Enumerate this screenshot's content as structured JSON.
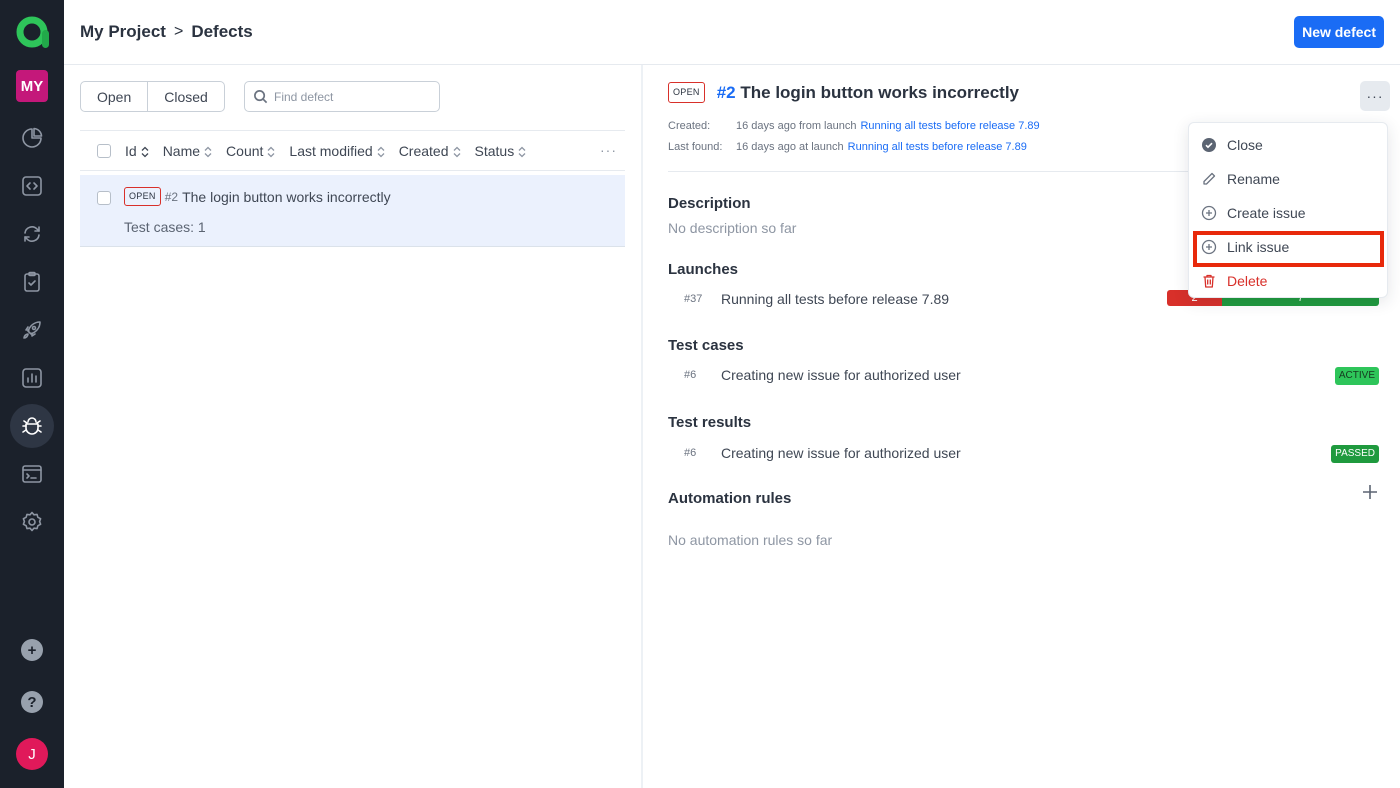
{
  "sidebar": {
    "project_badge": "MY",
    "nav": [
      {
        "name": "dashboards",
        "icon": "pie-chart-icon",
        "active": false
      },
      {
        "name": "code",
        "icon": "code-icon",
        "active": false
      },
      {
        "name": "jobs",
        "icon": "refresh-icon",
        "active": false
      },
      {
        "name": "test-cases",
        "icon": "clipboard-check-icon",
        "active": false
      },
      {
        "name": "launches",
        "icon": "rocket-icon",
        "active": false
      },
      {
        "name": "analytics",
        "icon": "bar-chart-icon",
        "active": false
      },
      {
        "name": "defects",
        "icon": "bug-icon",
        "active": true
      },
      {
        "name": "terminal",
        "icon": "terminal-icon",
        "active": false
      },
      {
        "name": "settings",
        "icon": "gear-icon",
        "active": false
      }
    ],
    "add_label": "+",
    "help_label": "?",
    "avatar_initial": "J"
  },
  "header": {
    "breadcrumb": [
      "My Project",
      "Defects"
    ],
    "breadcrumb_separator": ">",
    "new_defect_label": "New defect"
  },
  "list": {
    "filters": [
      "Open",
      "Closed"
    ],
    "search_placeholder": "Find defect",
    "columns": [
      "Id",
      "Name",
      "Count",
      "Last modified",
      "Created",
      "Status"
    ],
    "more_label": "···",
    "rows": [
      {
        "status": "OPEN",
        "id": "#2",
        "name": "The login button works incorrectly",
        "subtitle": "Test cases: 1"
      }
    ]
  },
  "detail": {
    "status": "OPEN",
    "id": "#2",
    "title": "The login button works incorrectly",
    "kebab_label": "···",
    "created_label": "Created:",
    "created_text": "16 days ago from launch",
    "created_link": "Running all tests before release 7.89",
    "last_found_label": "Last found:",
    "last_found_text": "16 days ago at launch",
    "last_found_link": "Running all tests before release 7.89",
    "description_title": "Description",
    "description_empty": "No description so far",
    "launches_title": "Launches",
    "launches": [
      {
        "id": "#37",
        "name": "Running all tests before release 7.89",
        "failed": "2",
        "passed": "7",
        "failed_fraction": 0.26
      }
    ],
    "test_cases_title": "Test cases",
    "test_cases": [
      {
        "id": "#6",
        "name": "Creating new issue for authorized user",
        "status": "ACTIVE"
      }
    ],
    "test_results_title": "Test results",
    "test_results": [
      {
        "id": "#6",
        "name": "Creating new issue for authorized user",
        "status": "PASSED"
      }
    ],
    "automation_title": "Automation rules",
    "automation_empty": "No automation rules so far"
  },
  "menu": {
    "items": [
      {
        "label": "Close",
        "icon": "check-circle-icon"
      },
      {
        "label": "Rename",
        "icon": "pencil-icon"
      },
      {
        "label": "Create issue",
        "icon": "plus-circle-icon"
      },
      {
        "label": "Link issue",
        "icon": "plus-circle-icon",
        "highlighted": true
      },
      {
        "label": "Delete",
        "icon": "trash-icon",
        "danger": true
      }
    ]
  },
  "colors": {
    "accent": "#1a6cf5",
    "sidebar_bg": "#1b212b",
    "project_badge": "#c4187a",
    "avatar": "#e0195a",
    "danger": "#d8302a",
    "success": "#1f9a3e",
    "highlight_box": "#e8290b"
  }
}
